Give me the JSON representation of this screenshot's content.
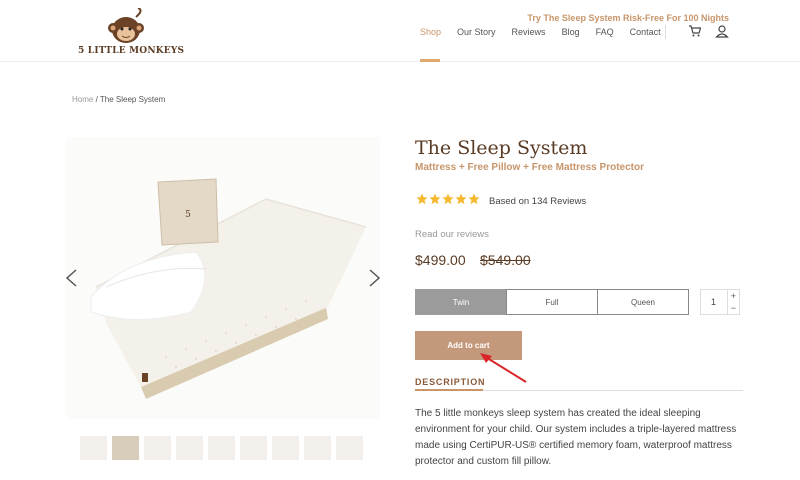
{
  "brand": {
    "name": "5 LITTLE MONKEYS"
  },
  "header": {
    "promo": "Try The Sleep System Risk-Free For 100 Nights",
    "nav": [
      "Shop",
      "Our Story",
      "Reviews",
      "Blog",
      "FAQ",
      "Contact"
    ],
    "active_nav": "Shop"
  },
  "breadcrumb": {
    "home": "Home",
    "separator": " / ",
    "current": "The Sleep System"
  },
  "product": {
    "title": "The Sleep System",
    "subtitle": "Mattress + Free Pillow + Free Mattress Protector",
    "rating": 5,
    "review_count": "Based on 134 Reviews",
    "read_reviews": "Read our reviews",
    "price": "$499.00",
    "old_price": "$549.00",
    "sizes": [
      "Twin",
      "Full",
      "Queen"
    ],
    "selected_size": "Twin",
    "quantity": "1",
    "qty_plus": "+",
    "qty_minus": "−",
    "add_to_cart": "Add to cart",
    "description_tab": "DESCRIPTION",
    "description": "The 5 little monkeys sleep system has created the ideal sleeping environment for your child. Our system includes a triple-layered mattress made using CertiPUR-US® certified memory foam, waterproof mattress protector and custom fill pillow.",
    "thumbnail_count": 9,
    "active_thumbnail": 1
  },
  "icons": {
    "cart": "cart-icon",
    "user": "user-icon",
    "prev": "chevron-left-icon",
    "next": "chevron-right-icon",
    "star": "star-icon"
  },
  "colors": {
    "accent": "#c8956a",
    "brand_brown": "#5a3b24",
    "button": "#c4987a",
    "star": "#f5b82e",
    "selected_size": "#9b9b9b",
    "annotation_arrow": "#d9262a"
  }
}
